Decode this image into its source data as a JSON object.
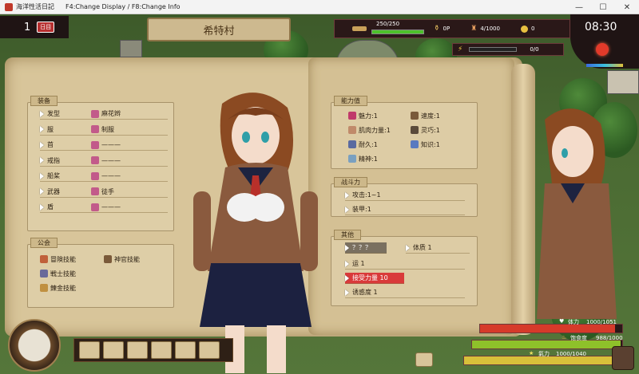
{
  "window": {
    "title": "海洋性活日記",
    "menu_hint": "F4:Change Display / F8:Change Info",
    "minimize": "—",
    "maximize": "☐",
    "close": "✕"
  },
  "day": {
    "number": "1",
    "tag": "日目"
  },
  "location": "希特村",
  "status": {
    "hp_text": "250/250",
    "hp_fraction": 1.0,
    "item1_value": "0",
    "item1_unit": "P",
    "item2_text": "4/1000",
    "money": "0",
    "energy_text": "0/0"
  },
  "clock": {
    "time": "08:30"
  },
  "equipment": {
    "label": "装备",
    "rows": [
      {
        "name": "发型",
        "value": "麻花辫"
      },
      {
        "name": "服",
        "value": "制服"
      },
      {
        "name": "首",
        "value": "———"
      },
      {
        "name": "戒指",
        "value": "———"
      },
      {
        "name": "船桨",
        "value": "———"
      },
      {
        "name": "武器",
        "value": "徒手"
      },
      {
        "name": "盾",
        "value": "———"
      }
    ]
  },
  "guild": {
    "label": "公会",
    "skills": [
      {
        "name": "冒険技能"
      },
      {
        "name": "神官技能"
      },
      {
        "name": "戦士技能"
      },
      {
        "name": "錬金技能"
      }
    ]
  },
  "ability": {
    "label": "能力值",
    "rows": [
      {
        "name": "魅力:1"
      },
      {
        "name": "速度:1"
      },
      {
        "name": "肌肉力量:1"
      },
      {
        "name": "灵巧:1"
      },
      {
        "name": "耐久:1"
      },
      {
        "name": "知识:1"
      },
      {
        "name": "精神:1"
      }
    ]
  },
  "combat": {
    "label": "战斗力",
    "attack": "攻击:1~1",
    "armor": "装甲:1"
  },
  "other": {
    "label": "其他",
    "rows": [
      {
        "name": "？？？"
      },
      {
        "name": "体质 1"
      },
      {
        "name": "运 1"
      },
      {
        "name": "接受力量 10"
      },
      {
        "name": "诱惑度 1"
      }
    ]
  },
  "bottom_stats": {
    "stamina_label": "体力",
    "stamina_text": "1000/1051",
    "stamina_fraction": 0.95,
    "food_label": "饱食度",
    "food_text": "988/1000",
    "food_fraction": 0.988,
    "spirit_label": "氣力",
    "spirit_text": "1000/1040",
    "spirit_fraction": 0.96
  },
  "colors": {
    "hp": "#4cc12a",
    "stamina": "#d63a2a",
    "food": "#8ec12a",
    "spirit": "#d8c03a",
    "highlight_row": "#d93a3a"
  }
}
